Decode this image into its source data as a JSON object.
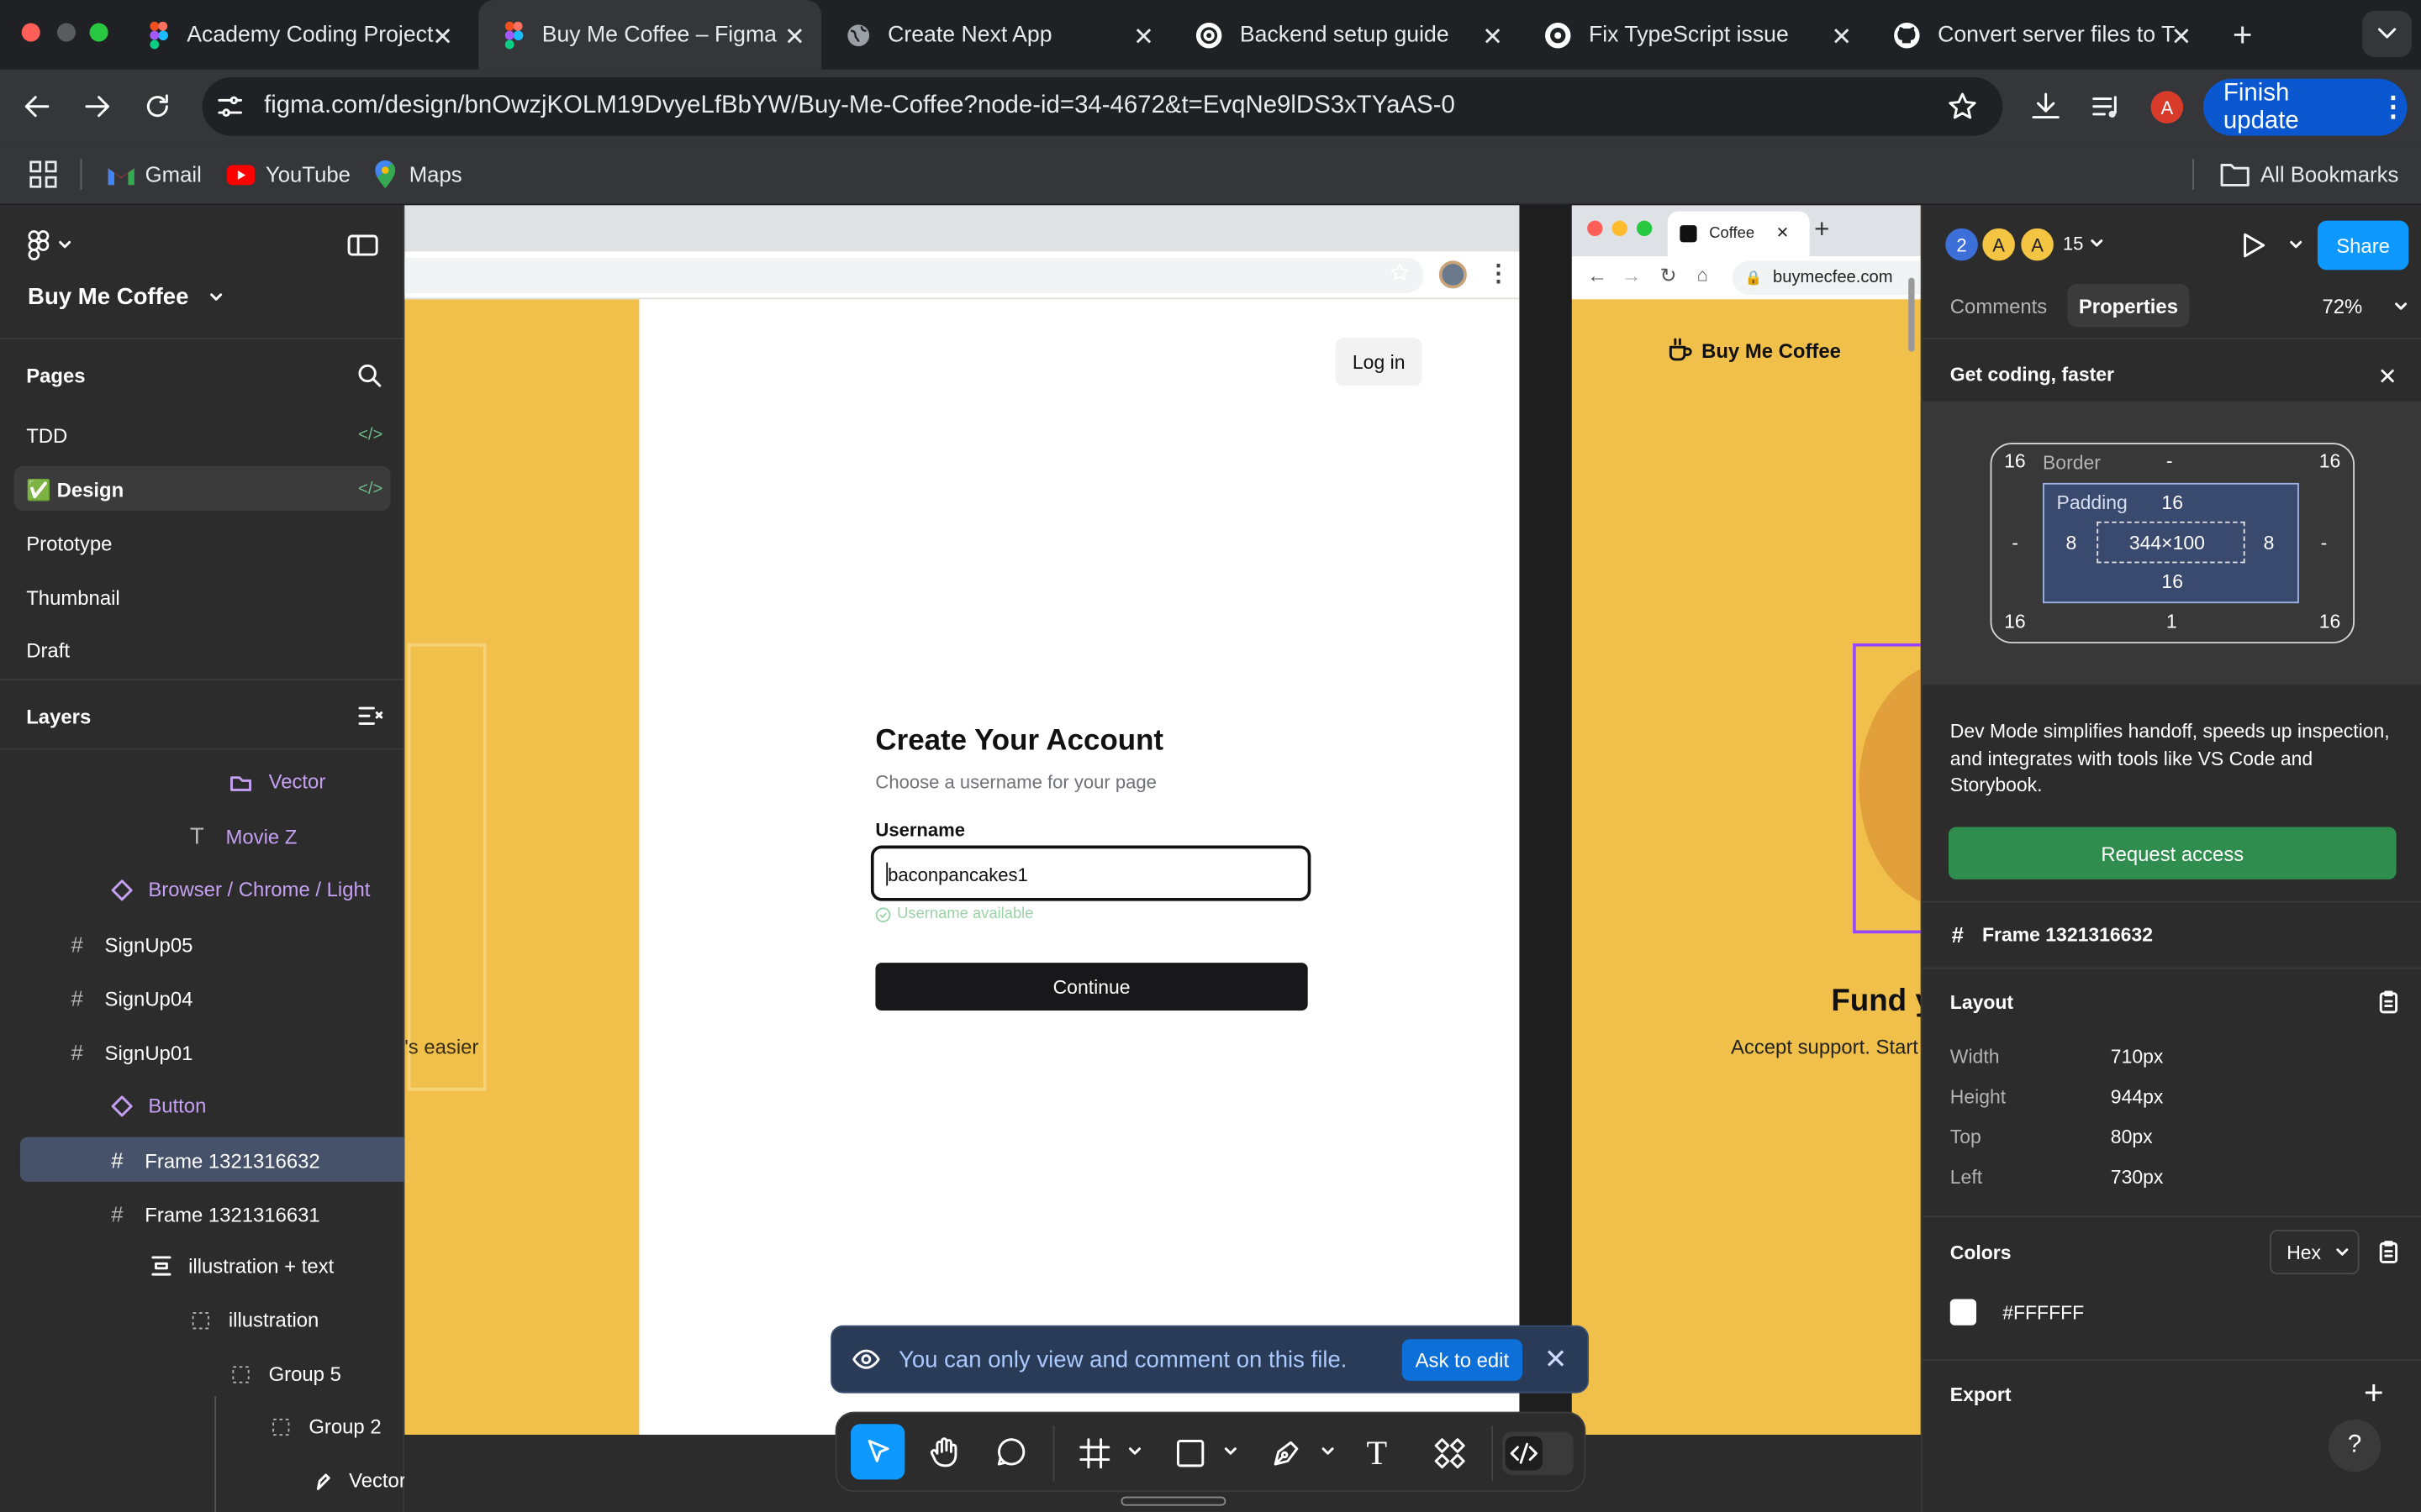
{
  "browser": {
    "tabs": [
      {
        "title": "Academy Coding Project",
        "icon": "figma-icon"
      },
      {
        "title": "Buy Me Coffee – Figma",
        "icon": "figma-icon"
      },
      {
        "title": "Create Next App",
        "icon": "globe-icon"
      },
      {
        "title": "Backend setup guide",
        "icon": "openai-icon"
      },
      {
        "title": "Fix TypeScript issue",
        "icon": "copilot-icon"
      },
      {
        "title": "Convert server files to T",
        "icon": "github-icon"
      }
    ],
    "url": "figma.com/design/bnOwzjKOLM19DvyeLfBbYW/Buy-Me-Coffee?node-id=34-4672&t=EvqNe9lDS3xTYaAS-0",
    "profile_initial": "A",
    "finish_update_label": "Finish update",
    "bookmarks": [
      "Gmail",
      "YouTube",
      "Maps"
    ],
    "all_bookmarks_label": "All Bookmarks"
  },
  "figma": {
    "file_name": "Buy Me Coffee",
    "pages_label": "Pages",
    "pages": [
      "TDD",
      "✅ Design",
      "Prototype",
      "Thumbnail",
      "Draft"
    ],
    "layers_label": "Layers",
    "layers": [
      "Vector",
      "Movie Z",
      "Browser / Chrome / Light",
      "SignUp05",
      "SignUp04",
      "SignUp01",
      "Button",
      "Frame 1321316632",
      "Frame 1321316631",
      "illustration + text",
      "illustration",
      "Group 5",
      "Group 2",
      "Vector"
    ],
    "canvas": {
      "login_label": "Log in",
      "side_text": "'s easier",
      "create_title": "Create Your Account",
      "create_subtitle": "Choose a username for your page",
      "username_label": "Username",
      "username_value": "baconpancakes1",
      "username_status": "Username available",
      "continue_label": "Continue",
      "right_tab_title": "Coffee",
      "right_url": "buymecfee.com",
      "right_logo": "Buy Me Coffee",
      "right_heading": "Fund y",
      "right_sub": "Accept support. Start"
    },
    "banner": {
      "text": "You can only view and comment on this file.",
      "ask_label": "Ask to edit"
    },
    "right_panel": {
      "avatars": [
        "2",
        "A",
        "A"
      ],
      "viewer_count": "15",
      "share_label": "Share",
      "tabs": [
        "Comments",
        "Properties"
      ],
      "zoom": "72%",
      "get_coding": "Get coding, faster",
      "box": {
        "margin_top_left": "16",
        "border_label": "Border",
        "border_top": "-",
        "margin_top_right": "16",
        "padding_label": "Padding",
        "padding_top": "16",
        "border_left": "-",
        "padding_left": "8",
        "size": "344×100",
        "padding_right": "8",
        "border_right": "-",
        "padding_bottom": "16",
        "margin_bottom_left": "16",
        "border_bottom": "1",
        "margin_bottom_right": "16"
      },
      "devmode_text": "Dev Mode simplifies handoff, speeds up inspection, and integrates with tools like VS Code and Storybook.",
      "request_label": "Request access",
      "frame_name": "Frame 1321316632",
      "layout_label": "Layout",
      "layout": [
        {
          "label": "Width",
          "value": "710px"
        },
        {
          "label": "Height",
          "value": "944px"
        },
        {
          "label": "Top",
          "value": "80px"
        },
        {
          "label": "Left",
          "value": "730px"
        }
      ],
      "colors_label": "Colors",
      "color_format": "Hex",
      "color_value": "#FFFFFF",
      "export_label": "Export",
      "help": "?"
    }
  },
  "colors": {
    "figma_blue": "#0d99ff",
    "accent_yellow": "#f1c04b",
    "purple_layer": "#c5a0f2",
    "request_green": "#2f8d4e"
  }
}
